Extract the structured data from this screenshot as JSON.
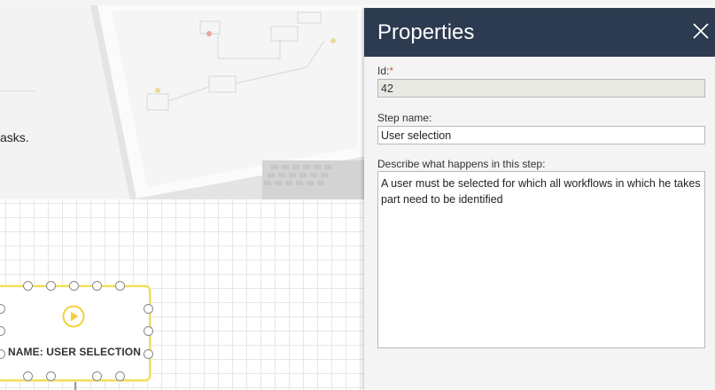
{
  "background": {
    "intro_text": "asks."
  },
  "node": {
    "label": "NAME: USER SELECTION",
    "icon": "play-circle-icon",
    "accent_color": "#f3dc5a"
  },
  "properties": {
    "title": "Properties",
    "close_icon": "close-icon",
    "header_color": "#2c3b4f",
    "id_label": "Id:",
    "id_required_mark": "*",
    "id_value": "42",
    "step_name_label": "Step name:",
    "step_name_value": "User selection",
    "description_label": "Describe what happens in this step:",
    "description_value": "A user must be selected for which all workflows in which he takes part need to be identified"
  }
}
